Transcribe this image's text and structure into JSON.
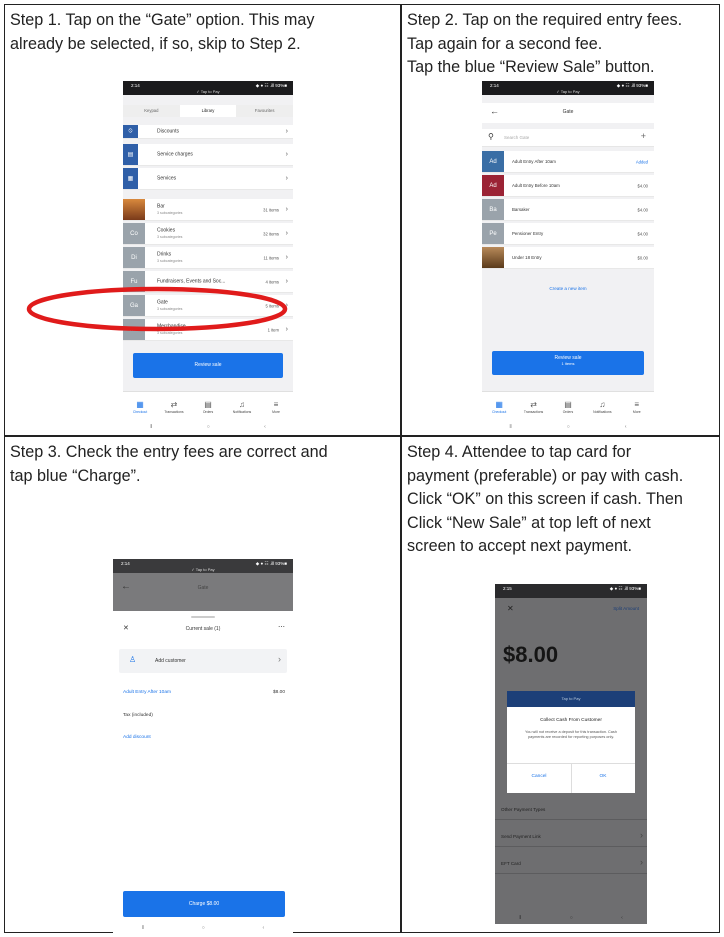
{
  "steps": [
    {
      "lines": [
        "Step 1. Tap on the “Gate” option. This may",
        "already be selected, if so, skip to Step 2."
      ]
    },
    {
      "lines": [
        "Step 2. Tap on the required entry fees.",
        "Tap again for a second fee.",
        "Tap the blue “Review Sale” button."
      ]
    },
    {
      "lines": [
        "Step 3. Check the entry fees are correct and",
        "tap blue “Charge”."
      ]
    },
    {
      "lines": [
        "Step 4. Attendee to tap card for",
        "payment (preferable) or pay with cash.",
        "Click “OK” on this screen if cash. Then",
        "Click “New Sale” at top left of next",
        "screen to accept next payment."
      ]
    }
  ],
  "status_bar": {
    "time": "2:14",
    "right": "◆ ● ☷ .ill 93%■",
    "tap_to_pay": "✓ Tap to Pay"
  },
  "status_bar_4": {
    "time": "2:15"
  },
  "screen1": {
    "tabs": [
      "Keypad",
      "Library",
      "Favourites"
    ],
    "rows": [
      {
        "label": "Discounts"
      },
      {
        "label": "Service charges"
      },
      {
        "label": "Services"
      },
      {
        "label": "Bar",
        "sub": "3 subcategories",
        "count": "31 items"
      },
      {
        "abbr": "Co",
        "label": "Cookies",
        "sub": "3 subcategories",
        "count": "32 items"
      },
      {
        "abbr": "Di",
        "label": "Drinks",
        "sub": "3 subcategories",
        "count": "11 items"
      },
      {
        "abbr": "Fu",
        "label": "Fundraisers, Events and Soc...",
        "sub": "",
        "count": "4 items"
      },
      {
        "abbr": "Ga",
        "label": "Gate",
        "sub": "3 subcategories",
        "count": "5 items"
      },
      {
        "abbr": "Me",
        "label": "Merchandise",
        "sub": "3 subcategories",
        "count": "1 item"
      }
    ],
    "review_label": "Review sale"
  },
  "bottom_tabs": [
    "Checkout",
    "Transactions",
    "Orders",
    "Notifications",
    "More"
  ],
  "screen2": {
    "title": "Gate",
    "search_placeholder": "Search Gate",
    "items": [
      {
        "abbr": "Ad",
        "label": "Adult Entry After 10am",
        "price": "Added"
      },
      {
        "abbr": "Ad",
        "label": "Adult Entry Before 10am",
        "price": "$4.00"
      },
      {
        "abbr": "Ba",
        "label": "Barsaker",
        "price": "$4.00"
      },
      {
        "abbr": "Pe",
        "label": "Pensioner Entry",
        "price": "$4.00"
      },
      {
        "abbr": "",
        "label": "Under 18 Entry",
        "price": "$0.00"
      }
    ],
    "create_label": "Create a new item",
    "review_label": "Review sale",
    "review_sub": "1 items"
  },
  "screen3": {
    "title": "Gate",
    "sale_header": "Current sale (1)",
    "add_customer": "Add customer",
    "line_item": "Adult Entry After 10am",
    "line_price": "$8.00",
    "tax": "Tax (included)",
    "add_discount": "Add discount",
    "charge_label": "Charge $8.00"
  },
  "screen4": {
    "split": "Split Amount",
    "amount": "$8.00",
    "tap_header": "Tap to Pay",
    "dialog_title": "Collect Cash From Customer",
    "dialog_body": "You will not receive a deposit for this transaction. Cash payments are recorded for reporting purposes only.",
    "cancel": "Cancel",
    "ok": "OK",
    "options": [
      "Other Payment Types",
      "Send Payment Link",
      "EFT Card"
    ]
  },
  "colors": {
    "accent": "#1a73e8",
    "circle": "#e01b1b",
    "dark": "#1b1b1d",
    "gate_sq": "#9aa3ab",
    "ad_blue": "#3a6ea5",
    "ad_red": "#9b2335"
  }
}
